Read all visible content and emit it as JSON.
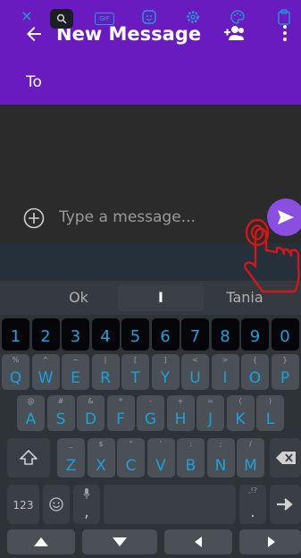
{
  "header": {
    "title": "New Message",
    "to_label": "To",
    "bg_color": "#6a1bbf"
  },
  "compose": {
    "placeholder": "Type a message...",
    "send_color": "#8a4fe0"
  },
  "keyboard": {
    "toolbar": [
      "×",
      "search-icon",
      "GIF",
      "sticker-icon",
      "gear-icon",
      "palette-icon",
      "clipboard-icon"
    ],
    "suggestions": [
      "Ok",
      "I",
      "Tania"
    ],
    "number_row": [
      "1",
      "2",
      "3",
      "4",
      "5",
      "6",
      "7",
      "8",
      "9",
      "0"
    ],
    "row1": [
      {
        "k": "Q",
        "h": "%"
      },
      {
        "k": "W",
        "h": "^"
      },
      {
        "k": "E",
        "h": "~"
      },
      {
        "k": "R",
        "h": "|"
      },
      {
        "k": "T",
        "h": "["
      },
      {
        "k": "Y",
        "h": "]"
      },
      {
        "k": "U",
        "h": "<"
      },
      {
        "k": "I",
        "h": ">"
      },
      {
        "k": "O",
        "h": "{"
      },
      {
        "k": "P",
        "h": "}"
      }
    ],
    "row2": [
      {
        "k": "A",
        "h": "@"
      },
      {
        "k": "S",
        "h": "#"
      },
      {
        "k": "D",
        "h": "&"
      },
      {
        "k": "F",
        "h": "*"
      },
      {
        "k": "G",
        "h": "-"
      },
      {
        "k": "H",
        "h": "+"
      },
      {
        "k": "J",
        "h": "="
      },
      {
        "k": "K",
        "h": "("
      },
      {
        "k": "L",
        "h": ")"
      }
    ],
    "row3": [
      {
        "k": "Z",
        "h": "_"
      },
      {
        "k": "X",
        "h": "$"
      },
      {
        "k": "C",
        "h": "\""
      },
      {
        "k": "V",
        "h": "'"
      },
      {
        "k": "B",
        "h": ":"
      },
      {
        "k": "N",
        "h": ";"
      },
      {
        "k": "M",
        "h": "/"
      }
    ],
    "bottom": {
      "num_switch": "123",
      "comma": ",",
      "period": ".",
      "period_hint": ",!?"
    },
    "accent_color": "#1da1d8"
  }
}
